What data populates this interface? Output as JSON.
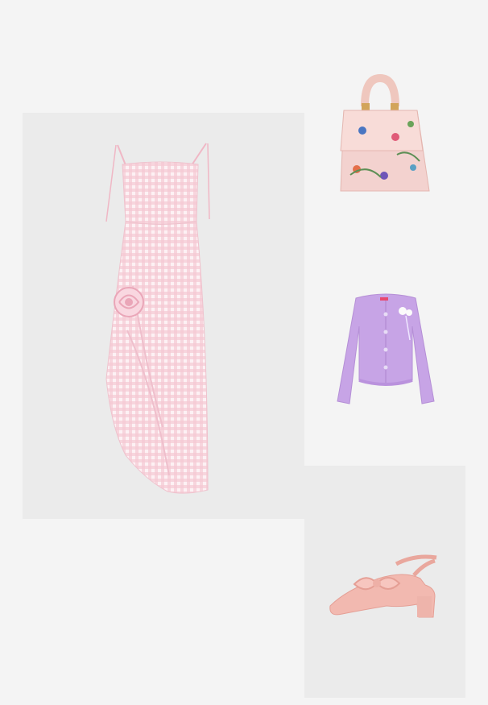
{
  "outfit": {
    "items": [
      {
        "icon": "dress-icon",
        "color": "#f6c9d4"
      },
      {
        "icon": "handbag-icon",
        "color": "#f3d2cf"
      },
      {
        "icon": "cardigan-icon",
        "color": "#c7a4e6"
      },
      {
        "icon": "shoe-icon",
        "color": "#f2b9b0"
      }
    ],
    "colors": {
      "page_background": "#f4f4f4",
      "tile_background": "#ebebeb"
    }
  }
}
